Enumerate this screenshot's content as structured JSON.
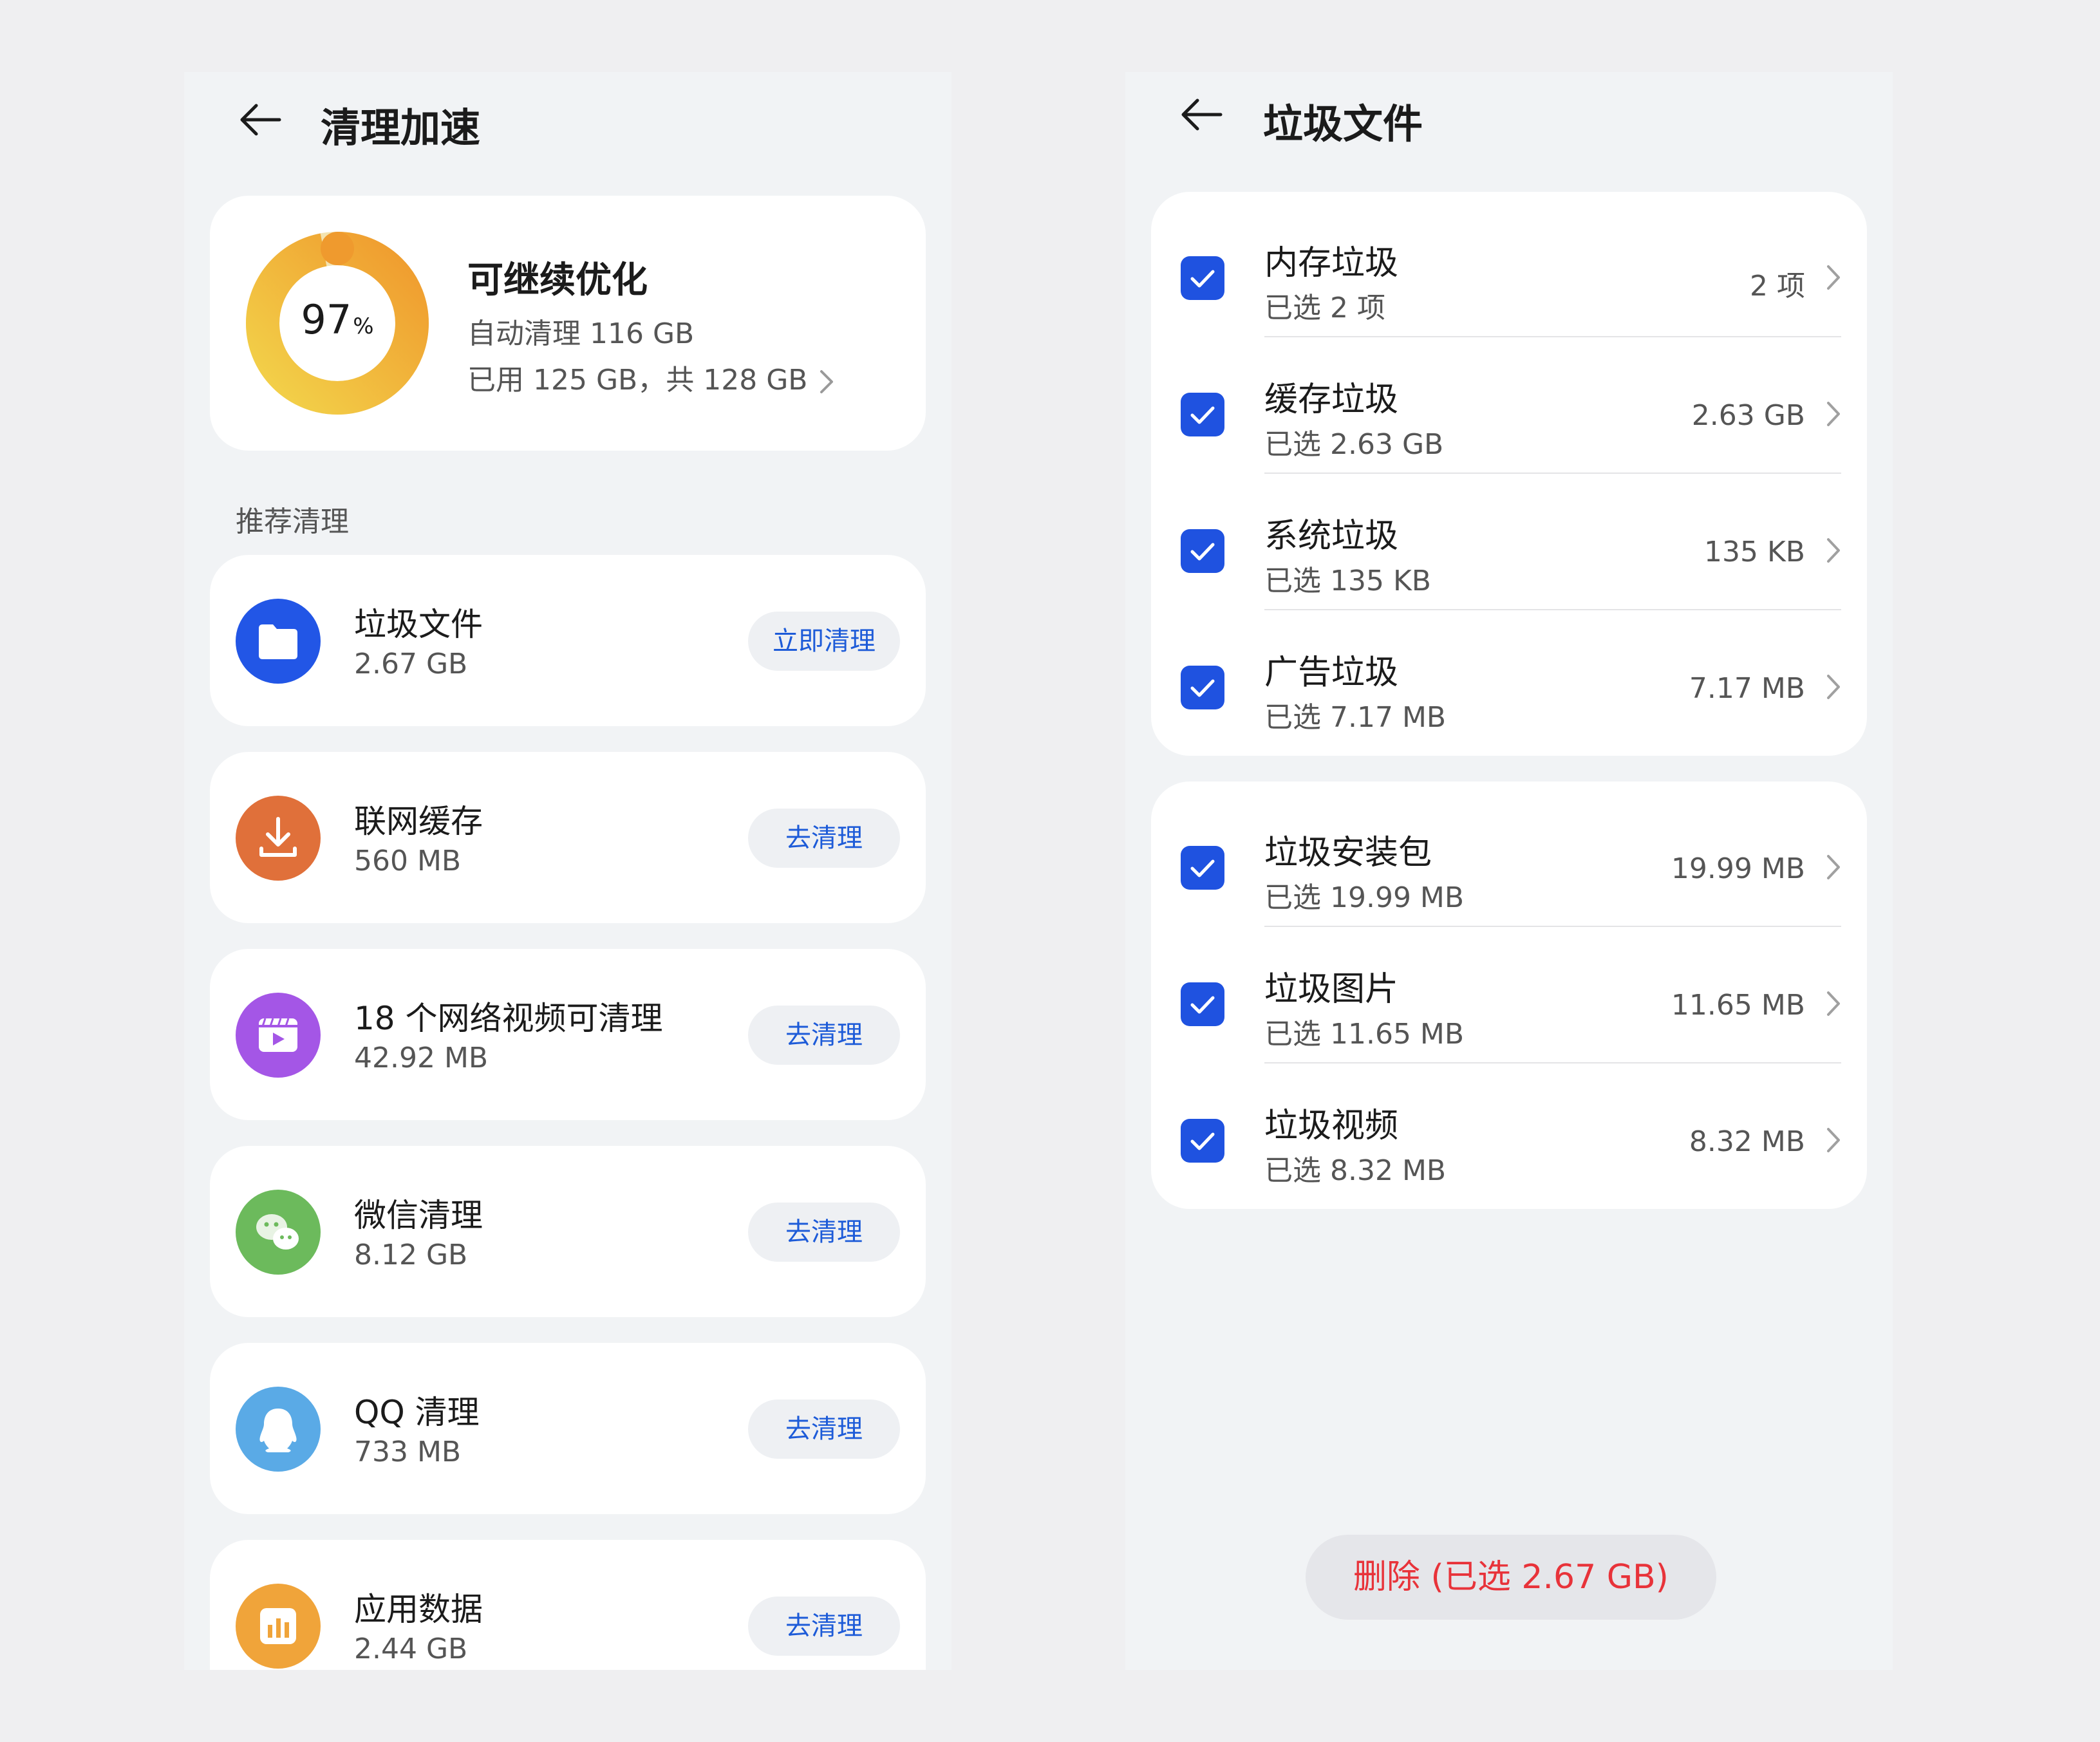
{
  "left": {
    "title": "清理加速",
    "summary": {
      "percent": "97",
      "percent_unit": "%",
      "title": "可继续优化",
      "line1": "自动清理 116 GB",
      "line2": "已用 125 GB，共 128 GB",
      "progress_fraction": 0.97,
      "ring_color_start": "#ef9a2e",
      "ring_color_end": "#f3d34a"
    },
    "section_label": "推荐清理",
    "items": [
      {
        "title": "垃圾文件",
        "size": "2.67 GB",
        "button": "立即清理",
        "icon": "folder-icon",
        "color": "#2256e6"
      },
      {
        "title": "联网缓存",
        "size": "560 MB",
        "button": "去清理",
        "icon": "download-icon",
        "color": "#e0703a"
      },
      {
        "title": "18 个网络视频可清理",
        "size": "42.92 MB",
        "button": "去清理",
        "icon": "video-icon",
        "color": "#a456e6"
      },
      {
        "title": "微信清理",
        "size": "8.12 GB",
        "button": "去清理",
        "icon": "wechat-icon",
        "color": "#6cba5c"
      },
      {
        "title": "QQ 清理",
        "size": "733 MB",
        "button": "去清理",
        "icon": "qq-icon",
        "color": "#5aaae6"
      },
      {
        "title": "应用数据",
        "size": "2.44 GB",
        "button": "去清理",
        "icon": "app-data-icon",
        "color": "#f0a43a"
      }
    ]
  },
  "right": {
    "title": "垃圾文件",
    "group1": [
      {
        "title": "内存垃圾",
        "sub": "已选 2 项",
        "value": "2 项"
      },
      {
        "title": "缓存垃圾",
        "sub": "已选 2.63 GB",
        "value": "2.63 GB"
      },
      {
        "title": "系统垃圾",
        "sub": "已选 135 KB",
        "value": "135 KB"
      },
      {
        "title": "广告垃圾",
        "sub": "已选 7.17 MB",
        "value": "7.17 MB"
      }
    ],
    "group2": [
      {
        "title": "垃圾安装包",
        "sub": "已选 19.99 MB",
        "value": "19.99 MB"
      },
      {
        "title": "垃圾图片",
        "sub": "已选 11.65 MB",
        "value": "11.65 MB"
      },
      {
        "title": "垃圾视频",
        "sub": "已选 8.32 MB",
        "value": "8.32 MB"
      }
    ],
    "delete_label": "删除 (已选 2.67 GB)",
    "accent_color": "#1f52e0",
    "danger_color": "#e8333a"
  }
}
